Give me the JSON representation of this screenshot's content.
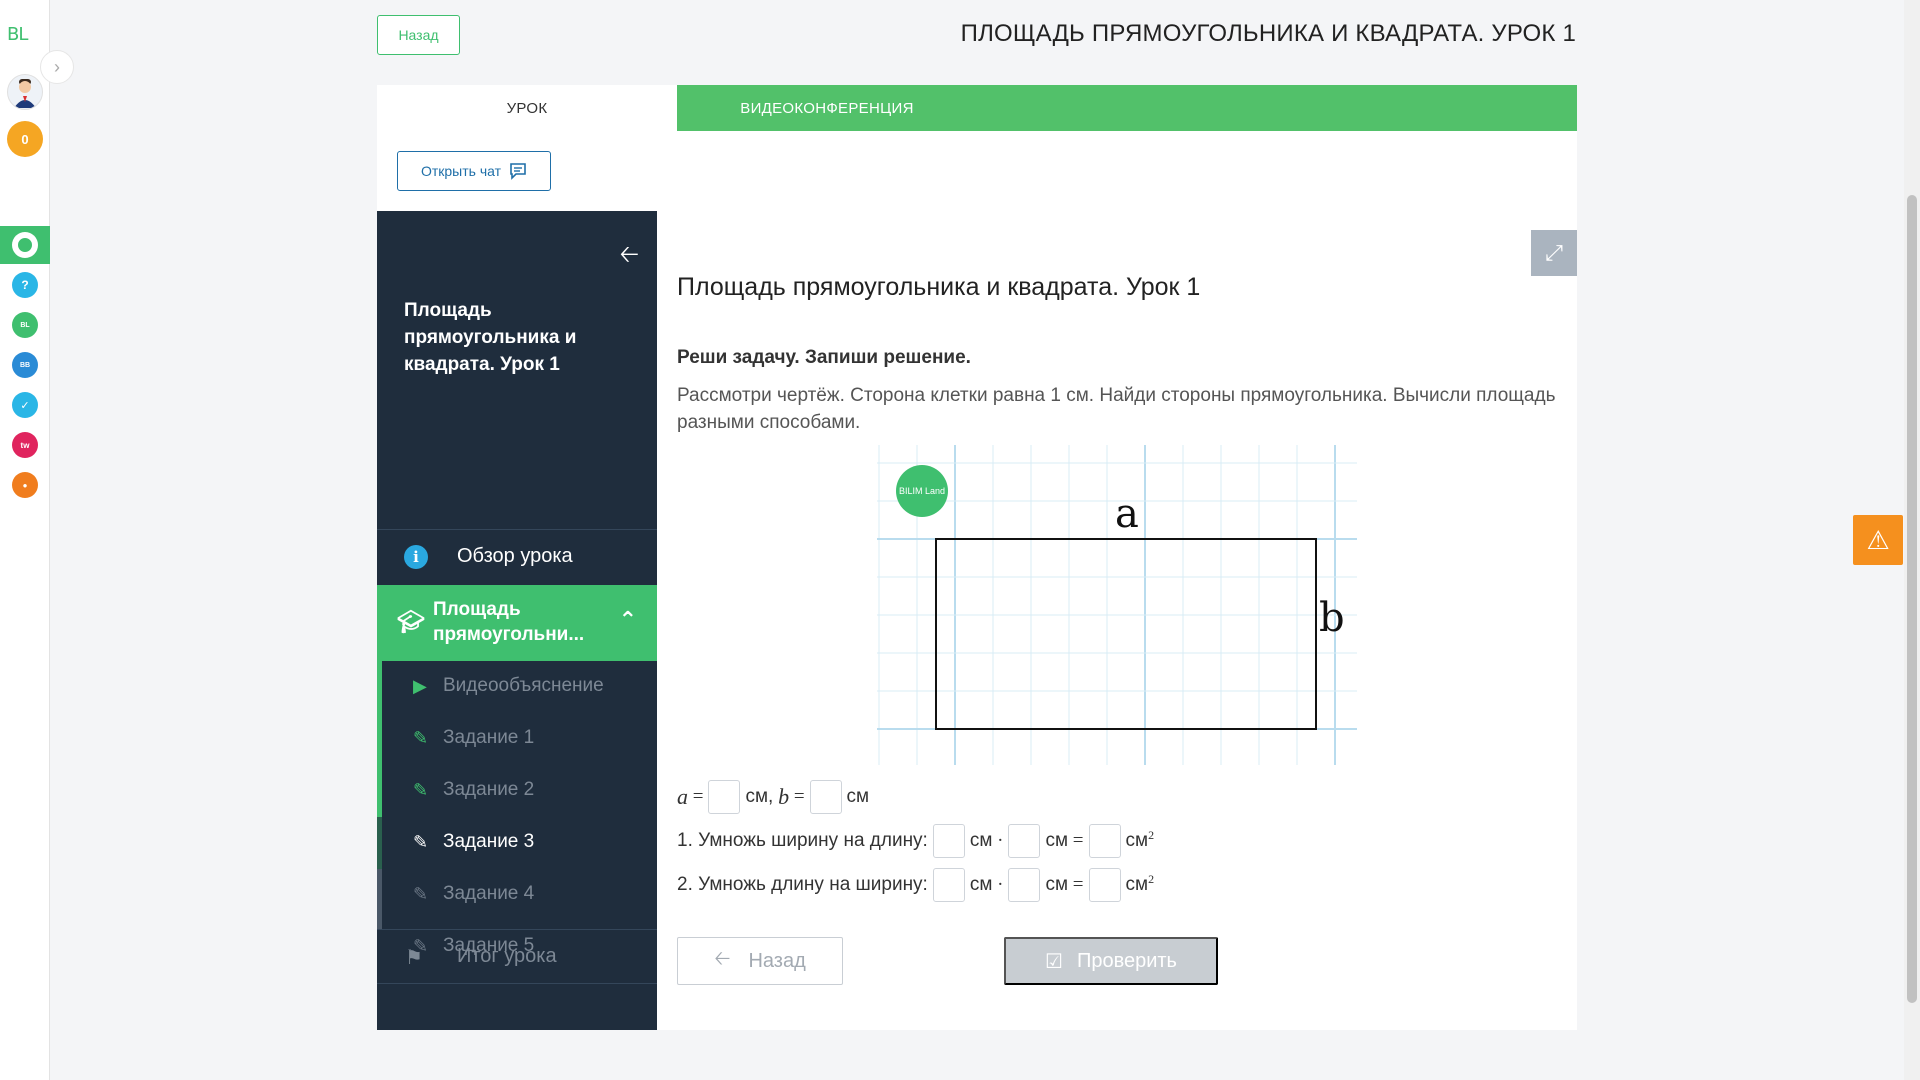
{
  "rail": {
    "logo": "BL",
    "coins": "0",
    "apps": [
      {
        "icon": "bilim-online-icon",
        "color": "#3fbf6f"
      },
      {
        "icon": "help-icon",
        "color": "#2ab6e6"
      },
      {
        "icon": "bilim-land-icon",
        "color": "#3fbf6f"
      },
      {
        "icon": "bilim-book-icon",
        "color": "#2a8bd6"
      },
      {
        "icon": "tasks-icon",
        "color": "#2ab6e6"
      },
      {
        "icon": "twig-icon",
        "color": "#e0245e"
      },
      {
        "icon": "smart-icon",
        "color": "#f07d1e"
      }
    ]
  },
  "header": {
    "back_label": "Назад",
    "title": "ПЛОЩАДЬ ПРЯМОУГОЛЬНИКА И КВАДРАТА. УРОК 1"
  },
  "tabs": [
    {
      "label": "УРОК",
      "active": true
    },
    {
      "label": "ВИДЕОКОНФЕРЕНЦИЯ",
      "active": false
    }
  ],
  "chat_button": "Открыть чат",
  "sidebar": {
    "course_title": "Площадь прямоугольника и квадрата. Урок 1",
    "overview": "Обзор урока",
    "section": "Площадь прямоугольни...",
    "items": [
      {
        "label": "Видеообъяснение",
        "status": "done",
        "icon": "play-icon"
      },
      {
        "label": "Задание 1",
        "status": "done",
        "icon": "edit-icon"
      },
      {
        "label": "Задание 2",
        "status": "done",
        "icon": "edit-icon"
      },
      {
        "label": "Задание 3",
        "status": "current",
        "icon": "edit-icon"
      },
      {
        "label": "Задание 4",
        "status": "pending",
        "icon": "edit-icon"
      },
      {
        "label": "Задание 5",
        "status": "pending",
        "icon": "edit-icon"
      }
    ],
    "summary": "Итог урока"
  },
  "content": {
    "lesson_title": "Площадь прямоугольника и квадрата. Урок 1",
    "task_heading": "Реши задачу. Запиши решение.",
    "task_text": "Рассмотри чертёж. Сторона клетки равна 1 см. Найди стороны прямоугольника. Вычисли площадь разными способами.",
    "figure": {
      "badge": "BILIM Land",
      "label_a": "a",
      "label_b": "b",
      "rect_cells_wide": 10,
      "rect_cells_high": 5
    },
    "eq0": {
      "a_var": "a",
      "b_var": "b",
      "equals": "=",
      "unit": "см",
      "comma": "см,"
    },
    "eq1": {
      "label": "1. Умножь ширину на длину:",
      "unit": "см",
      "dot": "·",
      "equals": "=",
      "unit_sq": "см",
      "sup": "2"
    },
    "eq2": {
      "label": "2. Умножь длину на ширину:",
      "unit": "см",
      "dot": "·",
      "equals": "=",
      "unit_sq": "см",
      "sup": "2"
    },
    "back_button": "Назад",
    "check_button": "Проверить"
  },
  "colors": {
    "accent_green": "#52c16a",
    "sidebar_bg": "#1f2d3d",
    "warning": "#f5901e"
  }
}
